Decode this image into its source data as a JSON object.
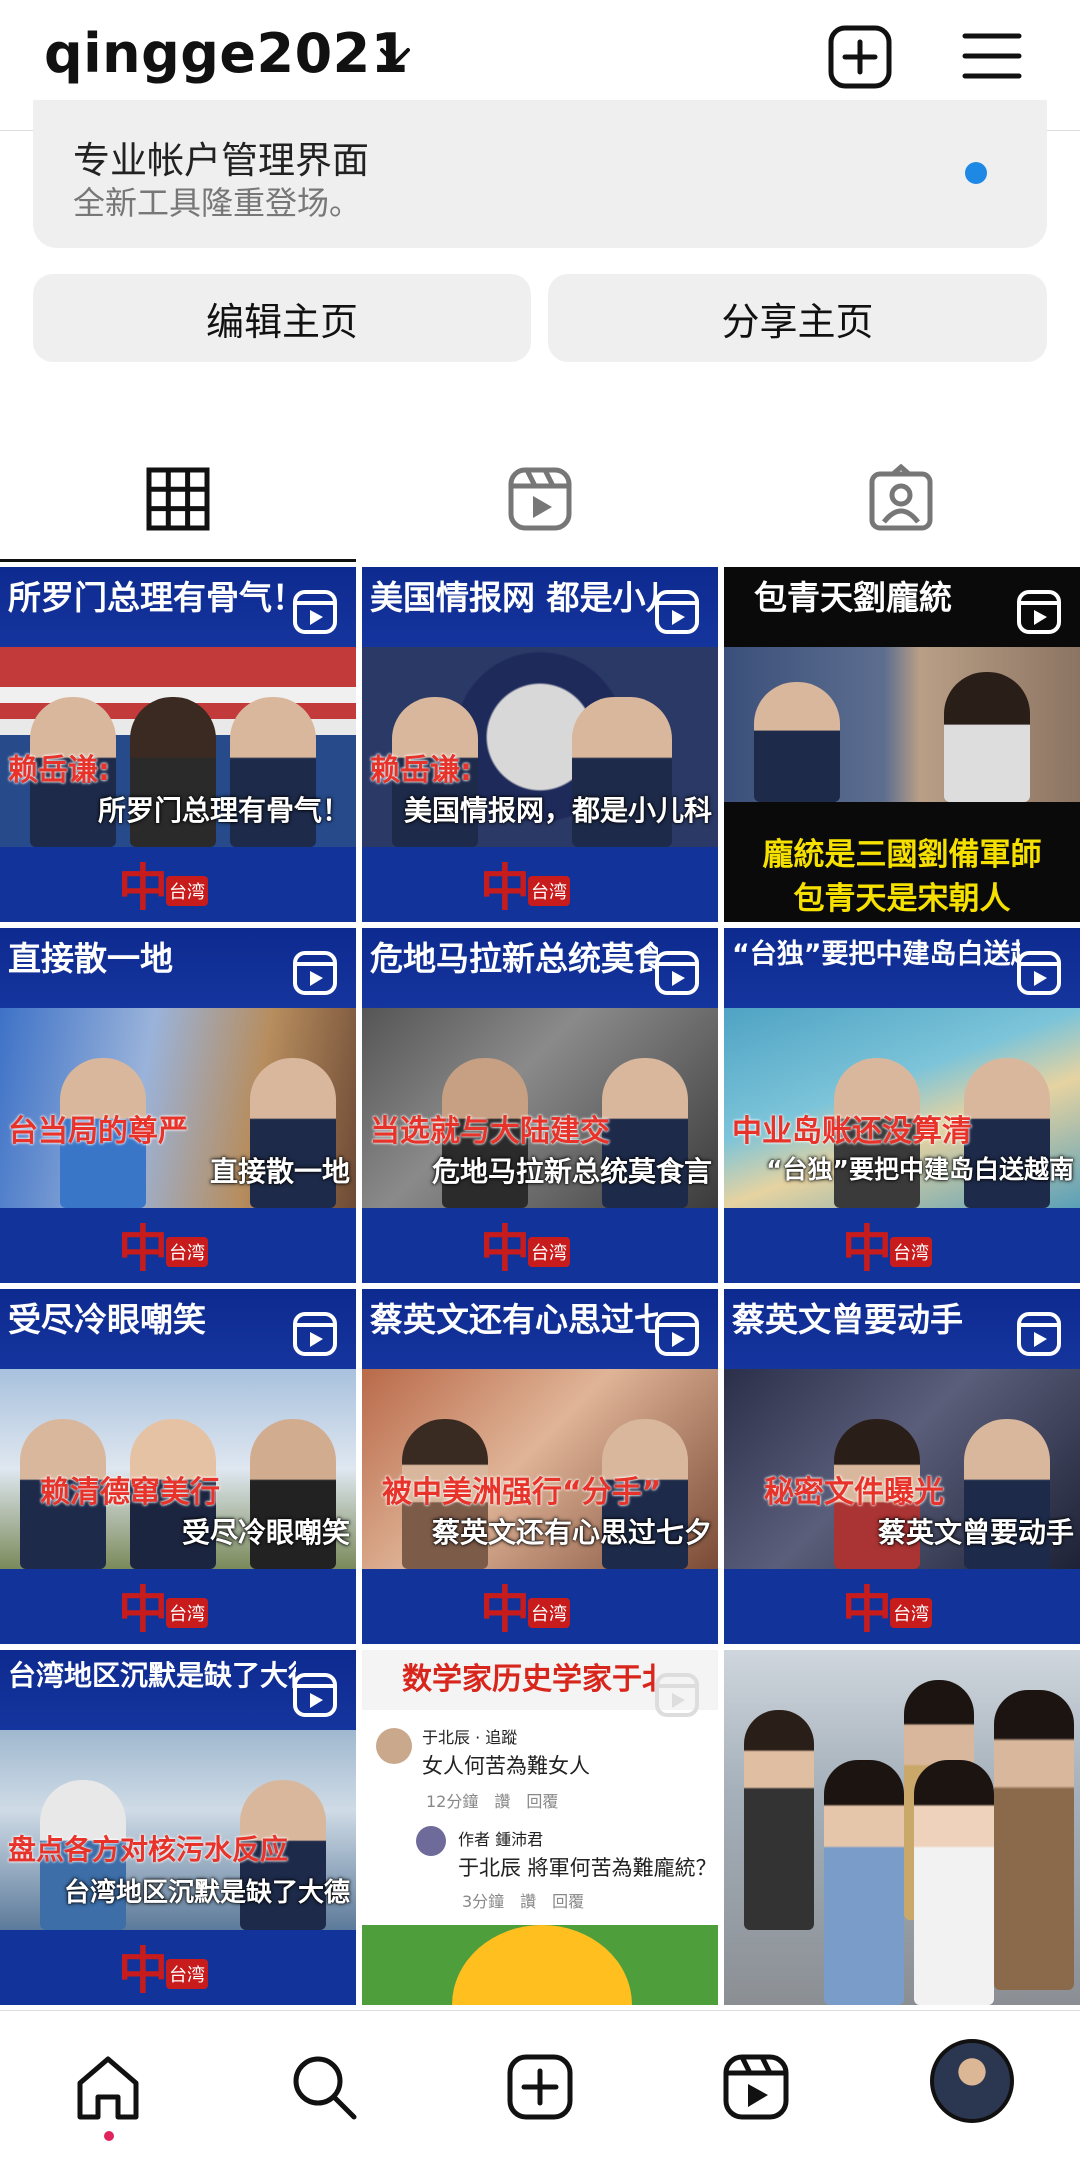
{
  "header": {
    "username": "qingge2021",
    "icons": [
      "chevron-down-icon",
      "add-post-icon",
      "menu-icon"
    ]
  },
  "pro_dashboard": {
    "title": "专业帐户管理界面",
    "subtitle": "全新工具隆重登场。",
    "dot_color": "#1e88e5"
  },
  "buttons": {
    "edit": "编辑主页",
    "share": "分享主页"
  },
  "tabs": [
    {
      "name": "grid-tab",
      "icon": "grid-icon",
      "selected": true
    },
    {
      "name": "reels-tab",
      "icon": "reels-icon",
      "selected": false
    },
    {
      "name": "tagged-tab",
      "icon": "tagged-icon",
      "selected": false
    }
  ],
  "posts": [
    {
      "headline": "所罗门总理有骨气！",
      "cap1": "赖岳谦:",
      "cap2": "所罗门总理有骨气！",
      "logo": "中",
      "logo_tag": "台湾"
    },
    {
      "headline": "美国情报网 都是小儿科",
      "cap1": "赖岳谦:",
      "cap2": "美国情报网，都是小儿科",
      "logo": "中",
      "logo_tag": "台湾"
    },
    {
      "headline": "包青天劉龐統",
      "line1": "龐統是三國劉備軍師",
      "line2": "包青天是宋朝人"
    },
    {
      "headline": "直接散一地",
      "cap1": "台当局的尊严",
      "cap2": "直接散一地",
      "logo": "中",
      "logo_tag": "台湾"
    },
    {
      "headline": "危地马拉新总统莫食言",
      "cap1": "当选就与大陆建交",
      "cap2": "危地马拉新总统莫食言",
      "logo": "中",
      "logo_tag": "台湾"
    },
    {
      "headline": "“台独”要把中建岛白送越南",
      "cap1": "中业岛账还没算清",
      "cap2": "“台独”要把中建岛白送越南",
      "logo": "中",
      "logo_tag": "台湾"
    },
    {
      "headline": "受尽冷眼嘲笑",
      "cap1": "赖清德窜美行",
      "cap2": "受尽冷眼嘲笑",
      "logo": "中",
      "logo_tag": "台湾"
    },
    {
      "headline": "蔡英文还有心思过七夕",
      "cap1": "被中美洲强行“分手”",
      "cap2": "蔡英文还有心思过七夕",
      "logo": "中",
      "logo_tag": "台湾"
    },
    {
      "headline": "蔡英文曾要动手",
      "cap1": "秘密文件曝光",
      "cap2": "蔡英文曾要动手",
      "logo": "中",
      "logo_tag": "台湾"
    },
    {
      "headline": "台湾地区沉默是缺了大德",
      "cap1": "盘点各方对核污水反应",
      "cap2": "台湾地区沉默是缺了大德",
      "logo": "中",
      "logo_tag": "台湾"
    },
    {
      "headline": "数学家历史学家于北辰",
      "comments": [
        {
          "author": "于北辰 · 追蹤",
          "text": "女人何苦為難女人",
          "meta": "12分鐘　讚　回覆"
        },
        {
          "author": "作者 鍾沛君",
          "text": "于北辰 將軍何苦為難龐統？",
          "meta": "3分鐘　讚　回覆"
        }
      ]
    },
    {
      "headline": ""
    }
  ],
  "bottom_nav": [
    {
      "name": "home",
      "icon": "home-icon"
    },
    {
      "name": "search",
      "icon": "search-icon"
    },
    {
      "name": "create",
      "icon": "add-post-icon"
    },
    {
      "name": "reels",
      "icon": "reels-icon"
    },
    {
      "name": "profile",
      "icon": "avatar"
    }
  ],
  "colors": {
    "accent": "#1e88e5",
    "notification_dot": "#e0245e",
    "post_blue": "#123399",
    "logo_red": "#c81c1c"
  }
}
